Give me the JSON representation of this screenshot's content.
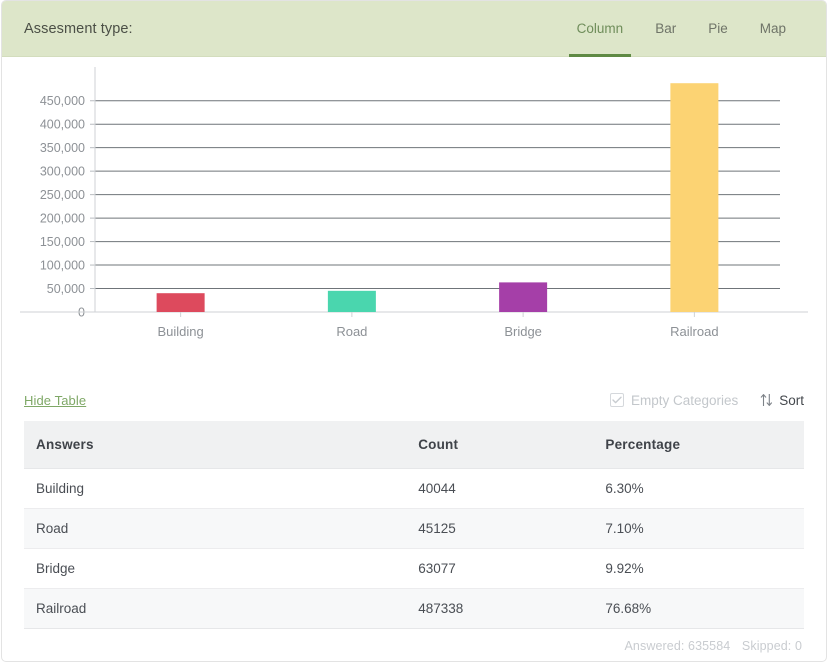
{
  "header": {
    "title": "Assesment type:",
    "tabs": [
      {
        "label": "Column",
        "active": true
      },
      {
        "label": "Bar",
        "active": false
      },
      {
        "label": "Pie",
        "active": false
      },
      {
        "label": "Map",
        "active": false
      }
    ]
  },
  "controls": {
    "hide_table_label": "Hide Table",
    "empty_categories_label": "Empty Categories",
    "empty_categories_checked": true,
    "sort_label": "Sort"
  },
  "table": {
    "columns": [
      "Answers",
      "Count",
      "Percentage"
    ],
    "rows": [
      {
        "answer": "Building",
        "count": "40044",
        "percentage": "6.30%"
      },
      {
        "answer": "Road",
        "count": "45125",
        "percentage": "7.10%"
      },
      {
        "answer": "Bridge",
        "count": "63077",
        "percentage": "9.92%"
      },
      {
        "answer": "Railroad",
        "count": "487338",
        "percentage": "76.68%"
      }
    ]
  },
  "footer": {
    "answered": "Answered: 635584",
    "skipped": "Skipped: 0"
  },
  "colors": {
    "header_bg": "#dde6c9",
    "tab_active": "#5f8a44",
    "link": "#7fa867",
    "bar_building": "#dd4a5d",
    "bar_road": "#4ad6ae",
    "bar_bridge": "#a53fa8",
    "bar_railroad": "#fcd373"
  },
  "chart_data": {
    "type": "bar",
    "title": "",
    "xlabel": "",
    "ylabel": "",
    "categories": [
      "Building",
      "Road",
      "Bridge",
      "Railroad"
    ],
    "values": [
      40044,
      45125,
      63077,
      487338
    ],
    "colors": [
      "#dd4a5d",
      "#4ad6ae",
      "#a53fa8",
      "#fcd373"
    ],
    "ylim": [
      0,
      475000
    ],
    "yticks": [
      0,
      50000,
      100000,
      150000,
      200000,
      250000,
      300000,
      350000,
      400000,
      450000
    ],
    "ytick_labels": [
      "0",
      "50,000",
      "100,000",
      "150,000",
      "200,000",
      "250,000",
      "300,000",
      "350,000",
      "400,000",
      "450,000"
    ],
    "grid": true,
    "legend": false
  }
}
